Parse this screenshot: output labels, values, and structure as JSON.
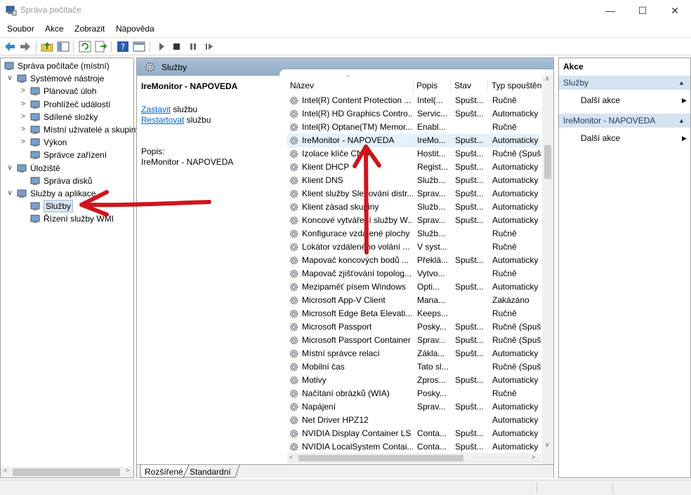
{
  "window": {
    "title": "Správa počítače",
    "controls": [
      "—",
      "☐",
      "✕"
    ]
  },
  "menu": [
    "Soubor",
    "Akce",
    "Zobrazit",
    "Nápověda"
  ],
  "tree": {
    "items": [
      {
        "label": "Správa počítače (místní)",
        "level": 0,
        "chev": ""
      },
      {
        "label": "Systémové nástroje",
        "level": 1,
        "chev": "∨"
      },
      {
        "label": "Plánovač úloh",
        "level": 2,
        "chev": ">"
      },
      {
        "label": "Prohlížeč událostí",
        "level": 2,
        "chev": ">"
      },
      {
        "label": "Sdílené složky",
        "level": 2,
        "chev": ">"
      },
      {
        "label": "Místní uživatelé a skupiny",
        "level": 2,
        "chev": ">"
      },
      {
        "label": "Výkon",
        "level": 2,
        "chev": ">"
      },
      {
        "label": "Správce zařízení",
        "level": 2,
        "chev": ""
      },
      {
        "label": "Úložiště",
        "level": 1,
        "chev": "∨"
      },
      {
        "label": "Správa disků",
        "level": 2,
        "chev": ""
      },
      {
        "label": "Služby a aplikace",
        "level": 1,
        "chev": "∨"
      },
      {
        "label": "Služby",
        "level": 2,
        "chev": ""
      },
      {
        "label": "Řízení služby WMI",
        "level": 2,
        "chev": ""
      }
    ]
  },
  "center": {
    "header": "Služby",
    "detail_title": "IreMonitor - NAPOVEDA",
    "stop_link": "Zastavit",
    "stop_rest": " službu",
    "restart_link": "Restartovat",
    "restart_rest": " službu",
    "desc_label": "Popis:",
    "desc_value": "IreMonitor - NAPOVEDA",
    "columns": {
      "name": "Název",
      "desc": "Popis",
      "state": "Stav",
      "start": "Typ spouštění"
    },
    "rows": [
      {
        "name": "Intel(R) Content Protection ...",
        "desc": "Intel(...",
        "state": "Spušt...",
        "start": "Ručně"
      },
      {
        "name": "Intel(R) HD Graphics Contro...",
        "desc": "Servic...",
        "state": "Spušt...",
        "start": "Automaticky"
      },
      {
        "name": "Intel(R) Optane(TM) Memor...",
        "desc": "Enabl...",
        "state": "",
        "start": "Ručně"
      },
      {
        "name": "IreMonitor - NAPOVEDA",
        "desc": "IreMo...",
        "state": "Spušt...",
        "start": "Automaticky"
      },
      {
        "name": "Izolace klíče CNG",
        "desc": "Hostit...",
        "state": "Spušt...",
        "start": "Ručně (Spuště"
      },
      {
        "name": "Klient DHCP",
        "desc": "Regist...",
        "state": "Spušt...",
        "start": "Automaticky"
      },
      {
        "name": "Klient DNS",
        "desc": "Služb...",
        "state": "Spušt...",
        "start": "Automaticky"
      },
      {
        "name": "Klient služby Sledování distr...",
        "desc": "Sprav...",
        "state": "Spušt...",
        "start": "Automaticky"
      },
      {
        "name": "Klient zásad skupiny",
        "desc": "Služb...",
        "state": "Spušt...",
        "start": "Automaticky"
      },
      {
        "name": "Koncové vytváření služby W...",
        "desc": "Sprav...",
        "state": "Spušt...",
        "start": "Automaticky"
      },
      {
        "name": "Konfigurace vzdálené plochy",
        "desc": "Služb...",
        "state": "",
        "start": "Ručně"
      },
      {
        "name": "Lokátor vzdáleného volání ...",
        "desc": "V syst...",
        "state": "",
        "start": "Ručně"
      },
      {
        "name": "Mapovač koncových bodů ...",
        "desc": "Překlá...",
        "state": "Spušt...",
        "start": "Automaticky"
      },
      {
        "name": "Mapovač zjišťování topolog...",
        "desc": "Vytvo...",
        "state": "",
        "start": "Ručně"
      },
      {
        "name": "Mezipaměť písem Windows",
        "desc": "Opti...",
        "state": "Spušt...",
        "start": "Automaticky"
      },
      {
        "name": "Microsoft App-V Client",
        "desc": "Mana...",
        "state": "",
        "start": "Zakázáno"
      },
      {
        "name": "Microsoft Edge Beta Elevati...",
        "desc": "Keeps...",
        "state": "",
        "start": "Ručně"
      },
      {
        "name": "Microsoft Passport",
        "desc": "Posky...",
        "state": "Spušt...",
        "start": "Ručně (Spuště"
      },
      {
        "name": "Microsoft Passport Container",
        "desc": "Sprav...",
        "state": "Spušt...",
        "start": "Ručně (Spuště"
      },
      {
        "name": "Místní správce relací",
        "desc": "Zákla...",
        "state": "Spušt...",
        "start": "Automaticky"
      },
      {
        "name": "Mobilní čas",
        "desc": "Tato sl...",
        "state": "",
        "start": "Ručně (Spuště"
      },
      {
        "name": "Motivy",
        "desc": "Zpros...",
        "state": "Spušt...",
        "start": "Automaticky"
      },
      {
        "name": "Načítání obrázků (WIA)",
        "desc": "Posky...",
        "state": "",
        "start": "Ručně"
      },
      {
        "name": "Napájení",
        "desc": "Sprav...",
        "state": "Spušt...",
        "start": "Automaticky"
      },
      {
        "name": "Net Driver HPZ12",
        "desc": "",
        "state": "",
        "start": "Automaticky"
      },
      {
        "name": "NVIDIA Display Container LS",
        "desc": "Conta...",
        "state": "Spušt...",
        "start": "Automaticky"
      },
      {
        "name": "NVIDIA LocalSystem Contai...",
        "desc": "Conta...",
        "state": "Spušt...",
        "start": "Automaticky"
      }
    ],
    "tabs": [
      "Rozšířené",
      "Standardní"
    ]
  },
  "actions": {
    "header": "Akce",
    "groups": [
      {
        "title": "Služby",
        "item": "Další akce"
      },
      {
        "title": "IreMonitor - NAPOVEDA",
        "item": "Další akce"
      }
    ]
  },
  "colors": {
    "annotation_arrow": "#d0141c",
    "selection": "#e5f1fb",
    "pane_header": "#a9c0d6"
  }
}
